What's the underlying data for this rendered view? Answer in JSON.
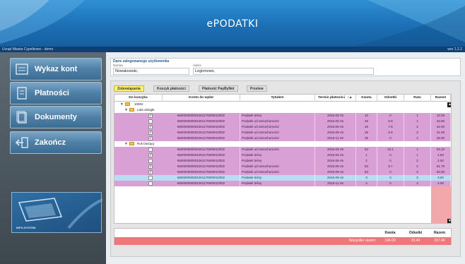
{
  "header": {
    "title": "ePODATKI"
  },
  "subbar": {
    "org": "Urząd Miasta Cypelkowo - demo",
    "version": "wer 1.2.2"
  },
  "sidebar": {
    "items": [
      {
        "label": "Wykaz kont",
        "icon": "ledger-icon"
      },
      {
        "label": "Płatności",
        "icon": "document-icon"
      },
      {
        "label": "Dokumenty",
        "icon": "document-stack-icon"
      },
      {
        "label": "Zakończ",
        "icon": "logout-icon"
      }
    ],
    "logo": {
      "text": "INFO-SYSTEM"
    }
  },
  "user": {
    "title": "Dane zalogowanego użytkownika",
    "name_label": "Nazwa",
    "name_value": "Nowakowski,",
    "address_label": "Adres",
    "address_value": "Legionowo,"
  },
  "tabs": [
    {
      "label": "Zobowiązania",
      "active": true
    },
    {
      "label": "Koszyk płatności",
      "active": false
    },
    {
      "label": "Płatność PayByNet",
      "active": false
    },
    {
      "label": "Przelew",
      "active": false
    }
  ],
  "table": {
    "columns": [
      "Do koszyka",
      "Konto do wpłat",
      "Tytułem",
      "Termin płatności",
      "Kwota",
      "Odsetki",
      "Rata",
      "Razem"
    ],
    "sort_glyph": "↕▲",
    "groups": {
      "root": "10002",
      "late": "Lata ubiegłe",
      "current": "Rok bieżący"
    },
    "rows": [
      {
        "checked": true,
        "account": "650000000001001170000010002",
        "title": "Podatek leśny",
        "date": "2015-03-15",
        "amount": "10",
        "interest": "0",
        "rate": "1",
        "total": "10.00",
        "color": "purple"
      },
      {
        "checked": false,
        "account": "650000000001001170000010002",
        "title": "Podatek od nieruchomości",
        "date": "2015-03-15",
        "amount": "25",
        "interest": "8.9",
        "rate": "1",
        "total": "33.90",
        "color": "purple"
      },
      {
        "checked": true,
        "account": "650000000001001170000010002",
        "title": "Podatek od nieruchomości",
        "date": "2015-06-15",
        "amount": "25",
        "interest": "7.9",
        "rate": "2",
        "total": "32.90",
        "color": "purple"
      },
      {
        "checked": true,
        "account": "650000000001001170000010002",
        "title": "Podatek od nieruchomości",
        "date": "2015-09-15",
        "amount": "25",
        "interest": "6.8",
        "rate": "3",
        "total": "31.80",
        "color": "purple"
      },
      {
        "checked": true,
        "account": "650000000001001170000010002",
        "title": "Podatek od nieruchomości",
        "date": "2015-11-15",
        "amount": "25",
        "interest": "0",
        "rate": "4",
        "total": "25.00",
        "color": "purple"
      },
      {
        "checked": false,
        "account": "650000000001001170000010002",
        "title": "Podatek od nieruchomości",
        "date": "2015-03-15",
        "amount": "53",
        "interest": "10.1",
        "rate": "1",
        "total": "63.10",
        "color": "purple"
      },
      {
        "checked": true,
        "account": "650000000001001170000010002",
        "title": "Podatek leśny",
        "date": "2015-03-15",
        "amount": "1",
        "interest": "0",
        "rate": "1",
        "total": "1.00",
        "color": "purple"
      },
      {
        "checked": false,
        "account": "650000000001001170000010002",
        "title": "Podatek leśny",
        "date": "2015-05-15",
        "amount": "2",
        "interest": "0",
        "rate": "2",
        "total": "2.00",
        "color": "purple"
      },
      {
        "checked": true,
        "account": "650000000001001170000010002",
        "title": "Podatek od nieruchomości",
        "date": "2015-05-15",
        "amount": "53",
        "interest": "8.7",
        "rate": "2",
        "total": "61.70",
        "color": "purple"
      },
      {
        "checked": true,
        "account": "650000000001001170000010002",
        "title": "Podatek od nieruchomości",
        "date": "2015-09-15",
        "amount": "53",
        "interest": "0",
        "rate": "3",
        "total": "53.00",
        "color": "purple"
      },
      {
        "checked": false,
        "account": "650000000001001170000010002",
        "title": "Podatek leśny",
        "date": "2015-09-15",
        "amount": "3",
        "interest": "0",
        "rate": "3",
        "total": "3.00",
        "color": "blue"
      },
      {
        "checked": false,
        "account": "650000000001001170000010002",
        "title": "Podatek leśny",
        "date": "2015-11-15",
        "amount": "4",
        "interest": "0",
        "rate": "4",
        "total": "4.00",
        "color": "purple"
      }
    ],
    "check_glyph": "✓"
  },
  "summary": {
    "headers": [
      "Kwota",
      "Odsetki",
      "Razem"
    ],
    "label": "Wszystko razem:",
    "amount": "194.00",
    "interest": "23.40",
    "total": "217.40"
  },
  "colors": {
    "header_blue": "#1c6fb5",
    "row_purple": "#d9a0d6",
    "row_blue": "#b9dcf3",
    "total_red": "#ee7777",
    "active_tab": "#fff27a"
  }
}
